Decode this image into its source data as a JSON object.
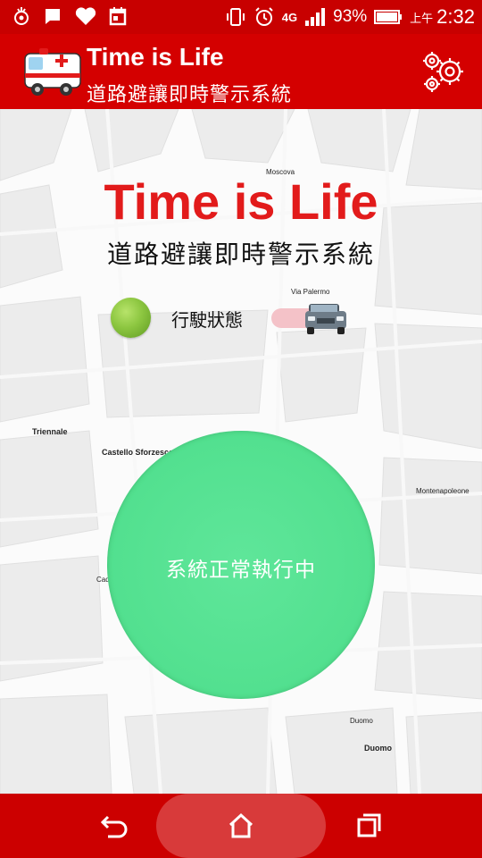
{
  "status_bar": {
    "battery_percent": "93%",
    "ampm": "上午",
    "time": "2:32",
    "network": "4G",
    "left_icons": [
      "notification-icon",
      "message-icon",
      "heart-icon",
      "calendar-icon"
    ],
    "right_icons": [
      "vibrate-icon",
      "alarm-icon",
      "network-4g-icon",
      "signal-icon",
      "battery-icon"
    ]
  },
  "app_bar": {
    "title": "Time is Life",
    "subtitle": "道路避讓即時警示系統",
    "logo_icon": "ambulance-icon",
    "settings_icon": "gears-icon"
  },
  "map": {
    "labels": {
      "moscova": "Moscova",
      "via_palermo": "Via Palermo",
      "triennale": "Triennale",
      "castello": "Castello Sforzesco",
      "montenapoleone": "Montenapoleone",
      "cadorna": "Cadorna FNM",
      "duomo_station": "Duomo",
      "duomo": "Duomo"
    }
  },
  "main": {
    "title": "Time is Life",
    "subtitle": "道路避讓即時警示系統",
    "status_label": "行駛狀態",
    "toggle_icon": "car-icon",
    "circle_text": "系統正常執行中",
    "status_color": "#8cc640",
    "circle_color": "#52e08f"
  },
  "colors": {
    "primary": "#d40000",
    "title_red": "#e21b1b"
  },
  "nav_bar": {
    "icons": [
      "back-icon",
      "home-icon",
      "recents-icon"
    ]
  }
}
